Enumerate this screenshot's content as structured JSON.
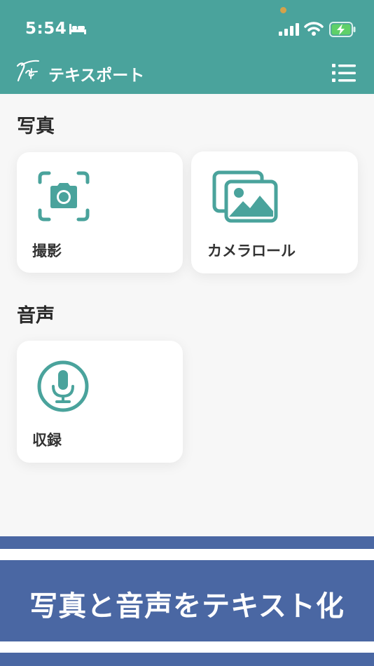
{
  "status_bar": {
    "time": "5:54"
  },
  "header": {
    "app_title": "テキスポート"
  },
  "sections": {
    "photo": {
      "title": "写真",
      "capture_label": "撮影",
      "camera_roll_label": "カメラロール"
    },
    "audio": {
      "title": "音声",
      "record_label": "収録"
    }
  },
  "banner": {
    "text": "写真と音声をテキスト化"
  },
  "colors": {
    "header_bg": "#4aa39c",
    "accent": "#4aa39c",
    "banner_bg": "#4a67a3",
    "background": "#f7f7f7"
  },
  "icons": [
    "bed-icon",
    "signal-icon",
    "wifi-icon",
    "battery-charging-icon",
    "logo-icon",
    "menu-icon",
    "camera-scan-icon",
    "gallery-icon",
    "microphone-icon"
  ]
}
